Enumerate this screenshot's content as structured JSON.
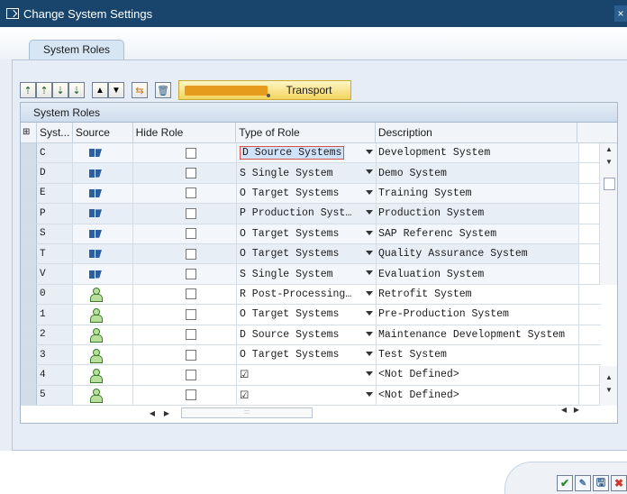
{
  "window": {
    "title": "Change System Settings",
    "close_glyph": "×"
  },
  "tab": {
    "label": "System Roles"
  },
  "toolbar": {
    "transport_label": "Transport"
  },
  "grid": {
    "title": "System Roles",
    "columns": [
      "Syst...",
      "Source",
      "Hide Role",
      "Type of Role",
      "Description"
    ],
    "rows": [
      {
        "sys": "C",
        "source": "system",
        "type": "D Source Systems",
        "desc": "Development System",
        "selected": true
      },
      {
        "sys": "D",
        "source": "system",
        "type": "S Single System",
        "desc": "Demo System"
      },
      {
        "sys": "E",
        "source": "system",
        "type": "O Target Systems",
        "desc": "Training System"
      },
      {
        "sys": "P",
        "source": "system",
        "type": "P Production Syst…",
        "desc": "Production System"
      },
      {
        "sys": "S",
        "source": "system",
        "type": "O Target Systems",
        "desc": "SAP Referenc System"
      },
      {
        "sys": "T",
        "source": "system",
        "type": "O Target Systems",
        "desc": "Quality Assurance System"
      },
      {
        "sys": "V",
        "source": "system",
        "type": "S Single System",
        "desc": "Evaluation System"
      },
      {
        "sys": "0",
        "source": "user",
        "type": "R Post-Processing…",
        "desc": "Retrofit System"
      },
      {
        "sys": "1",
        "source": "user",
        "type": "O Target Systems",
        "desc": "Pre-Production System"
      },
      {
        "sys": "2",
        "source": "user",
        "type": "D Source Systems",
        "desc": "Maintenance Development System"
      },
      {
        "sys": "3",
        "source": "user",
        "type": "O Target Systems",
        "desc": "Test System"
      },
      {
        "sys": "4",
        "source": "user",
        "type": "☑",
        "desc": "<Not Defined>"
      },
      {
        "sys": "5",
        "source": "user",
        "type": "☑",
        "desc": "<Not Defined>"
      }
    ]
  },
  "footer": {
    "ok_glyph": "✔",
    "save_glyph": "🖫",
    "cancel_glyph": "✖"
  }
}
